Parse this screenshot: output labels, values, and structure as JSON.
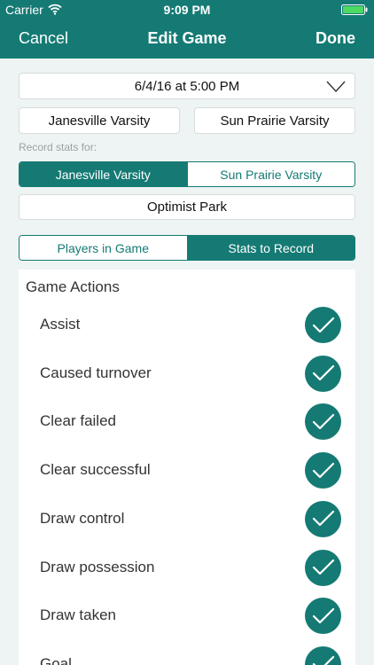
{
  "status_bar": {
    "carrier": "Carrier",
    "time": "9:09 PM"
  },
  "nav": {
    "cancel": "Cancel",
    "title": "Edit Game",
    "done": "Done"
  },
  "date_picker": {
    "value": "6/4/16 at 5:00 PM"
  },
  "teams": {
    "home": "Janesville Varsity",
    "away": "Sun Prairie Varsity"
  },
  "record_for": {
    "label": "Record stats for:",
    "options": [
      "Janesville Varsity",
      "Sun Prairie Varsity"
    ],
    "selected": "Janesville Varsity"
  },
  "location": {
    "value": "Optimist Park"
  },
  "view_toggle": {
    "options": [
      "Players in Game",
      "Stats to Record"
    ],
    "selected": "Stats to Record"
  },
  "game_actions": {
    "title": "Game Actions",
    "items": [
      {
        "label": "Assist",
        "checked": true
      },
      {
        "label": "Caused turnover",
        "checked": true
      },
      {
        "label": "Clear failed",
        "checked": true
      },
      {
        "label": "Clear successful",
        "checked": true
      },
      {
        "label": "Draw control",
        "checked": true
      },
      {
        "label": "Draw possession",
        "checked": true
      },
      {
        "label": "Draw taken",
        "checked": true
      },
      {
        "label": "Goal",
        "checked": true
      }
    ]
  },
  "colors": {
    "accent": "#157a74",
    "background": "#eef4f3"
  },
  "icons": {
    "wifi": "wifi-icon",
    "battery": "battery-icon",
    "chevron": "chevron-down-icon",
    "check": "check-circle-icon"
  }
}
